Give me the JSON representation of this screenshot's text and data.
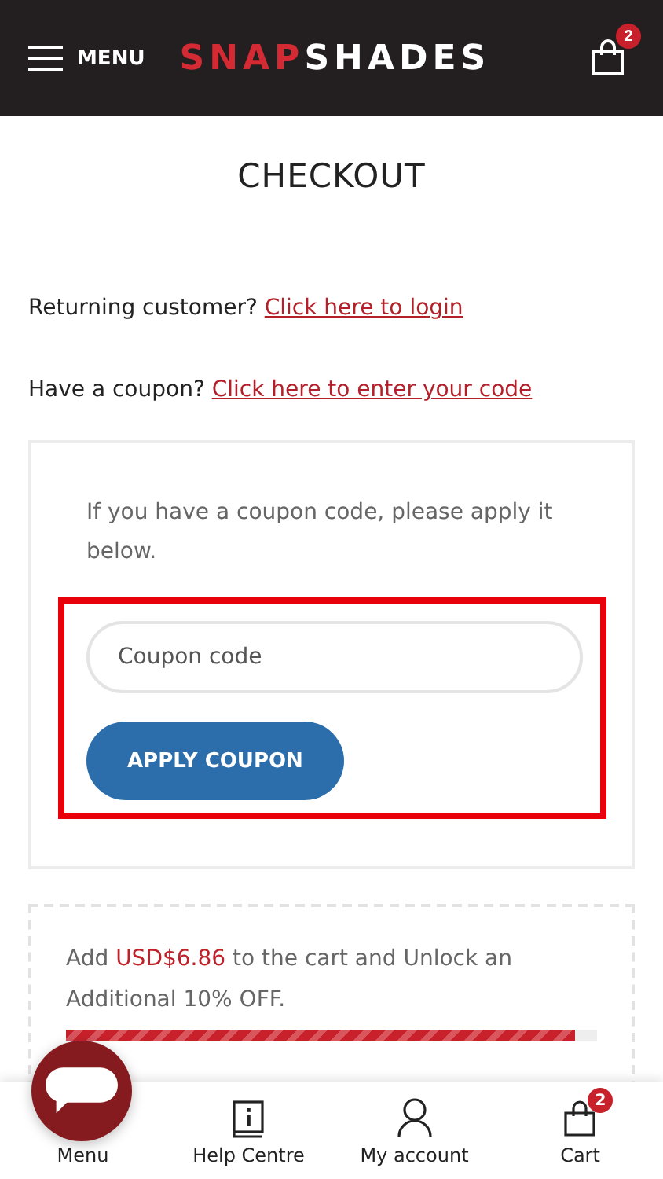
{
  "header": {
    "menu_label": "MENU",
    "logo_first": "SNAP",
    "logo_second": "SHADES",
    "cart_count": "2"
  },
  "title": "CHECKOUT",
  "returning": {
    "text": "Returning customer?",
    "link": "Click here to login"
  },
  "coupon_notice": {
    "text": "Have a coupon?",
    "link": "Click here to enter your code"
  },
  "coupon_form": {
    "intro": "If you have a coupon code, please apply it below.",
    "placeholder": "Coupon code",
    "button": "APPLY COUPON",
    "highlighted": true
  },
  "promo": {
    "text": "Add **USD$6.86** to the cart and Unlock an Additional 10% OFF.",
    "level": 0.96
  },
  "bottom_nav": [
    {
      "label": "Menu",
      "kind": "menu"
    },
    {
      "label": "Help Centre",
      "kind": "help"
    },
    {
      "label": "My account",
      "kind": "account"
    },
    {
      "label": "Cart",
      "kind": "cart",
      "badge": "2"
    }
  ]
}
